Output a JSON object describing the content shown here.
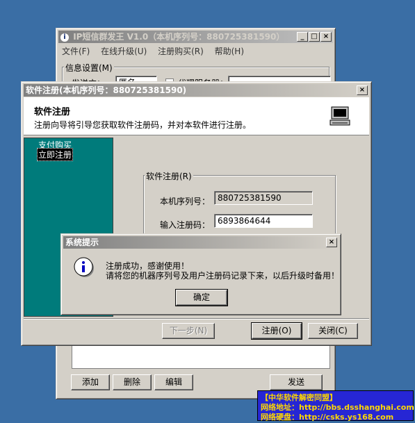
{
  "main_window": {
    "title": "IP短信群发王 V1.0（本机序列号：880725381590）",
    "menu": [
      "文件(F)",
      "在线升级(U)",
      "注册购买(R)",
      "帮助(H)"
    ],
    "group_label": "信息设置(M)",
    "send_label": "发送方：",
    "send_value": "匿名",
    "proxy_label": "代理服务器：",
    "buttons": {
      "add": "添加",
      "delete": "删除",
      "edit": "编辑",
      "send": "发送"
    }
  },
  "reg_window": {
    "title": "软件注册(本机序列号：880725381590)",
    "header_title": "软件注册",
    "header_desc": "注册向导将引导您获取软件注册码，并对本软件进行注册。",
    "nav": [
      "支付购买",
      "立即注册"
    ],
    "group_label": "软件注册(R)",
    "serial_label": "本机序列号：",
    "serial_value": "880725381590",
    "code_label": "输入注册码：",
    "code_value": "6893864644",
    "buttons": {
      "next": "下一步(N)",
      "register": "注册(O)",
      "close": "关闭(C)"
    }
  },
  "msgbox": {
    "title": "系统提示",
    "line1": "注册成功，感谢使用！",
    "line2": "请将您的机器序列号及用户注册码记录下来，以后升级时备用！",
    "ok": "确定"
  },
  "watermark": {
    "line1": "【中华软件解密同盟】",
    "line2": "网络地址：http://bbs.dsshanghai.com",
    "line3": "网络硬盘：http://csks.ys168.com"
  }
}
